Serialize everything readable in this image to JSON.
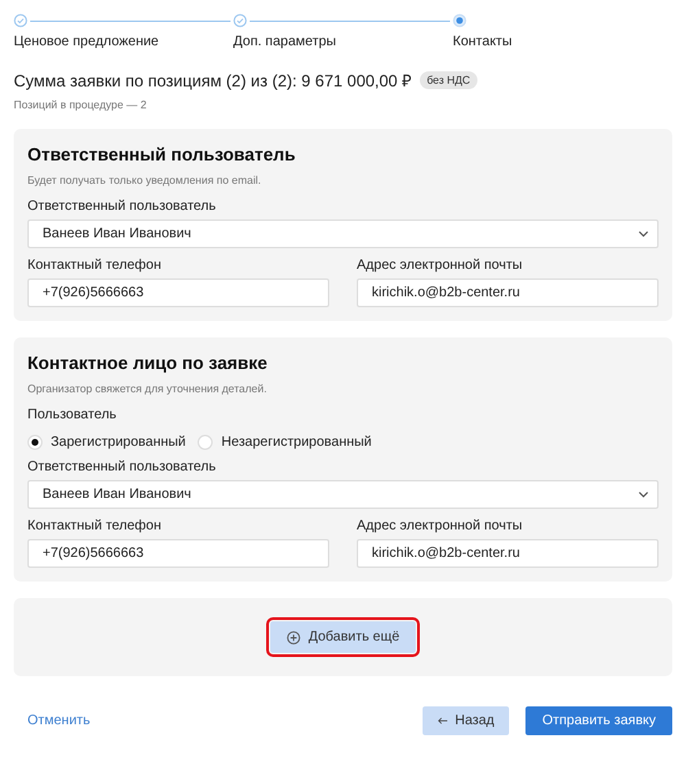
{
  "steps": [
    {
      "label": "Ценовое предложение",
      "completed": true,
      "selected": false
    },
    {
      "label": "Доп. параметры",
      "completed": true,
      "selected": false
    },
    {
      "label": "Контакты",
      "completed": false,
      "selected": true
    }
  ],
  "summary": {
    "text": "Сумма заявки по позициям (2) из (2): 9 671 000,00 ₽",
    "badge": "без НДС",
    "note": "Позиций в процедуре — 2"
  },
  "sections": [
    {
      "title": "Ответственный пользователь",
      "hint": "Будет получать только уведомления по email.",
      "rows": [
        [
          {
            "kind": "select",
            "label": "Ответственный пользователь",
            "value": "Ванеев Иван Иванович"
          }
        ],
        [
          {
            "kind": "input",
            "label": "Контактный телефон",
            "value": "+7(926)5666663"
          },
          {
            "kind": "input",
            "label": "Адрес электронной почты",
            "value": "kirichik.o@b2b-center.ru"
          }
        ]
      ]
    },
    {
      "title": "Контактное лицо по заявке",
      "hint": "Организатор свяжется для уточнения деталей.",
      "rows": [
        [
          {
            "kind": "radio",
            "label": "Пользователь",
            "options": [
              {
                "label": "Зарегистрированный",
                "selected": true
              },
              {
                "label": "Незарегистрированный",
                "selected": false
              }
            ]
          }
        ],
        [
          {
            "kind": "select",
            "label": "Ответственный пользователь",
            "value": "Ванеев Иван Иванович"
          }
        ],
        [
          {
            "kind": "input",
            "label": "Контактный телефон",
            "value": "+7(926)5666663"
          },
          {
            "kind": "input",
            "label": "Адрес электронной почты",
            "value": "kirichik.o@b2b-center.ru"
          }
        ]
      ]
    }
  ],
  "add_button": {
    "label": "Добавить ещё",
    "highlighted": true
  },
  "footer": {
    "cancel": "Отменить",
    "back": "Назад",
    "submit": "Отправить заявку"
  }
}
